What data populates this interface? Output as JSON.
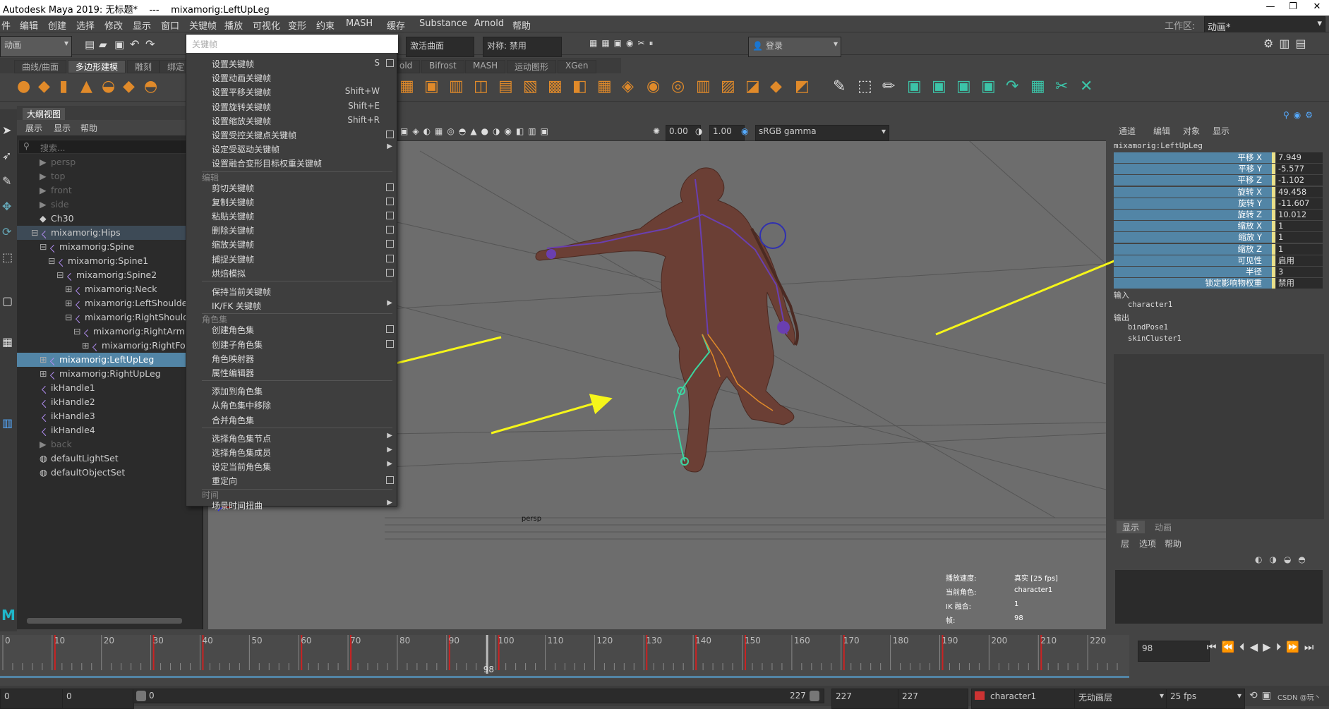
{
  "window": {
    "title": "Autodesk Maya 2019: 无标题*    ---    mixamorig:LeftUpLeg",
    "min": "—",
    "restore": "❐",
    "close": "✕"
  },
  "menubar": {
    "items": [
      "件",
      "编辑",
      "创建",
      "选择",
      "修改",
      "显示",
      "窗口",
      "关键帧",
      "播放",
      "可视化",
      "变形",
      "约束",
      "MASH",
      "缓存",
      "Substance",
      "Arnold",
      "帮助"
    ],
    "workspace_label": "工作区:",
    "workspace_value": "动画*"
  },
  "statusline": {
    "mode": "动画",
    "curve_field": "激活曲面",
    "symmetry": "对称: 禁用",
    "login": "登录"
  },
  "search": {
    "placeholder": "关键帧"
  },
  "shelf_tabs": [
    "曲线/曲面",
    "多边形建模",
    "雕刻",
    "绑定",
    "old",
    "Bifrost",
    "MASH",
    "运动图形",
    "XGen"
  ],
  "keyframe_menu": {
    "items": [
      {
        "label": "设置关键帧",
        "shortcut": "S",
        "box": true
      },
      {
        "label": "设置动画关键帧"
      },
      {
        "label": "设置平移关键帧",
        "shortcut": "Shift+W"
      },
      {
        "label": "设置旋转关键帧",
        "shortcut": "Shift+E"
      },
      {
        "label": "设置缩放关键帧",
        "shortcut": "Shift+R"
      },
      {
        "label": "设置受控关键点关键帧",
        "box": true
      },
      {
        "label": "设定受驱动关键帧",
        "arrow": true
      },
      {
        "label": "设置融合变形目标权重关键帧"
      },
      {
        "section": "编辑"
      },
      {
        "label": "剪切关键帧",
        "box": true
      },
      {
        "label": "复制关键帧",
        "box": true
      },
      {
        "label": "粘贴关键帧",
        "box": true
      },
      {
        "label": "删除关键帧",
        "box": true
      },
      {
        "label": "缩放关键帧",
        "box": true
      },
      {
        "label": "捕捉关键帧",
        "box": true
      },
      {
        "label": "烘焙模拟",
        "box": true
      },
      {
        "section": ""
      },
      {
        "label": "保持当前关键帧"
      },
      {
        "label": "IK/FK 关键帧",
        "arrow": true
      },
      {
        "section": "角色集"
      },
      {
        "label": "创建角色集",
        "box": true
      },
      {
        "label": "创建子角色集",
        "box": true
      },
      {
        "label": "角色映射器"
      },
      {
        "label": "属性编辑器"
      },
      {
        "section": ""
      },
      {
        "label": "添加到角色集"
      },
      {
        "label": "从角色集中移除"
      },
      {
        "label": "合并角色集"
      },
      {
        "section": ""
      },
      {
        "label": "选择角色集节点",
        "arrow": true
      },
      {
        "label": "选择角色集成员",
        "arrow": true
      },
      {
        "label": "设定当前角色集",
        "arrow": true
      },
      {
        "label": "重定向",
        "box": true
      },
      {
        "section": "时间"
      },
      {
        "label": "场景时间扭曲",
        "arrow": true
      }
    ]
  },
  "outliner": {
    "title": "大纲视图",
    "menu": [
      "展示",
      "显示",
      "帮助"
    ],
    "search_placeholder": "搜索...",
    "rows": [
      {
        "label": "persp",
        "indent": 0,
        "dim": true,
        "icon": "camera"
      },
      {
        "label": "top",
        "indent": 0,
        "dim": true,
        "icon": "camera"
      },
      {
        "label": "front",
        "indent": 0,
        "dim": true,
        "icon": "camera"
      },
      {
        "label": "side",
        "indent": 0,
        "dim": true,
        "icon": "camera"
      },
      {
        "label": "Ch30",
        "indent": 0,
        "icon": "transform"
      },
      {
        "label": "mixamorig:Hips",
        "indent": 0,
        "icon": "joint",
        "exp": "⊟",
        "hl": true
      },
      {
        "label": "mixamorig:Spine",
        "indent": 1,
        "icon": "joint",
        "exp": "⊟"
      },
      {
        "label": "mixamorig:Spine1",
        "indent": 2,
        "icon": "joint",
        "exp": "⊟"
      },
      {
        "label": "mixamorig:Spine2",
        "indent": 3,
        "icon": "joint",
        "exp": "⊟"
      },
      {
        "label": "mixamorig:Neck",
        "indent": 4,
        "icon": "joint",
        "exp": "⊞"
      },
      {
        "label": "mixamorig:LeftShoulder",
        "indent": 4,
        "icon": "joint",
        "exp": "⊞"
      },
      {
        "label": "mixamorig:RightShoulder",
        "indent": 4,
        "icon": "joint",
        "exp": "⊟"
      },
      {
        "label": "mixamorig:RightArm",
        "indent": 5,
        "icon": "joint",
        "exp": "⊟"
      },
      {
        "label": "mixamorig:RightForeArm",
        "indent": 6,
        "icon": "joint",
        "exp": "⊞"
      },
      {
        "label": "mixamorig:LeftUpLeg",
        "indent": 1,
        "icon": "joint",
        "exp": "⊞",
        "sel": true
      },
      {
        "label": "mixamorig:RightUpLeg",
        "indent": 1,
        "icon": "joint",
        "exp": "⊞"
      },
      {
        "label": "ikHandle1",
        "indent": 0,
        "icon": "ik"
      },
      {
        "label": "ikHandle2",
        "indent": 0,
        "icon": "ik"
      },
      {
        "label": "ikHandle3",
        "indent": 0,
        "icon": "ik"
      },
      {
        "label": "ikHandle4",
        "indent": 0,
        "icon": "ik"
      },
      {
        "label": "back",
        "indent": 0,
        "dim": true,
        "icon": "camera"
      },
      {
        "label": "defaultLightSet",
        "indent": 0,
        "icon": "set"
      },
      {
        "label": "defaultObjectSet",
        "indent": 0,
        "icon": "set"
      }
    ]
  },
  "viewport": {
    "near": "0.00",
    "far": "1.00",
    "colorspace": "sRGB gamma",
    "camera": "persp",
    "hud": {
      "playback_label": "播放速度:",
      "playback_value": "真实 [25 fps]",
      "char_label": "当前角色:",
      "char_value": "character1",
      "ik_label": "IK 融合:",
      "ik_value": "1",
      "frame_label": "帧:",
      "frame_value": "98"
    }
  },
  "channel_box": {
    "menu": [
      "通道",
      "编辑",
      "对象",
      "显示"
    ],
    "node": "mixamorig:LeftUpLeg",
    "attrs": [
      {
        "name": "平移 X",
        "value": "7.949"
      },
      {
        "name": "平移 Y",
        "value": "-5.577"
      },
      {
        "name": "平移 Z",
        "value": "-1.102"
      },
      {
        "name": "旋转 X",
        "value": "49.458"
      },
      {
        "name": "旋转 Y",
        "value": "-11.607"
      },
      {
        "name": "旋转 Z",
        "value": "10.012"
      },
      {
        "name": "缩放 X",
        "value": "1"
      },
      {
        "name": "缩放 Y",
        "value": "1"
      },
      {
        "name": "缩放 Z",
        "value": "1"
      },
      {
        "name": "可见性",
        "value": "启用"
      },
      {
        "name": "半径",
        "value": "3"
      },
      {
        "name": "锁定影响物权重",
        "value": "禁用"
      }
    ],
    "inputs_label": "输入",
    "inputs": [
      "character1"
    ],
    "outputs_label": "输出",
    "outputs": [
      "bindPose1",
      "skinCluster1"
    ],
    "layer_tabs": [
      "显示",
      "动画"
    ],
    "layer_menu": [
      "层",
      "选项",
      "帮助"
    ]
  },
  "timeline": {
    "ticks": [
      "0",
      "10",
      "20",
      "30",
      "40",
      "50",
      "60",
      "70",
      "80",
      "90",
      "100",
      "110",
      "120",
      "130",
      "140",
      "150",
      "160",
      "170",
      "180",
      "190",
      "200",
      "210",
      "220"
    ],
    "current": "98",
    "current_field": "98"
  },
  "range": {
    "start": "0",
    "start2": "0",
    "slider_start": "0",
    "slider_end": "227",
    "end": "227",
    "end2": "227",
    "character": "character1",
    "anim_layer": "无动画层",
    "fps": "25 fps",
    "watermark": "CSDN @玩丶"
  },
  "colors": {
    "selection": "#5285a6",
    "keyframe_menu_bg": "#3e3e3e",
    "arrow": "#f5f51a",
    "accent_orange": "#e08a2a"
  }
}
